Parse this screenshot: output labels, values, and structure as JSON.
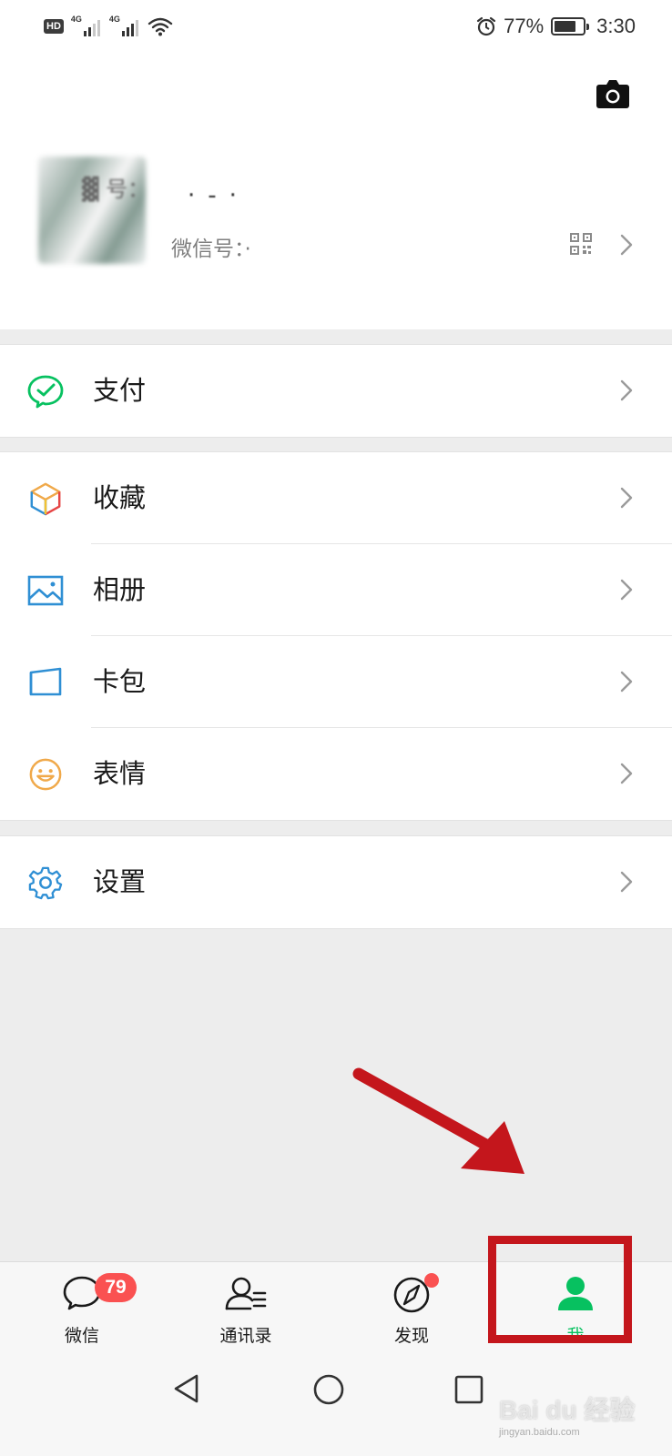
{
  "status_bar": {
    "hd": "HD",
    "network1": "4G",
    "network2": "4G",
    "battery_percent": "77%",
    "battery_level": 0.77,
    "time": "3:30",
    "icons": [
      "signal-icon",
      "wifi-icon",
      "alarm-icon",
      "battery-icon"
    ]
  },
  "profile": {
    "wechat_id_label": "微信号：·"
  },
  "menu": {
    "pay": {
      "label": "支付",
      "icon": "wechat-pay-icon",
      "color": "#07c160"
    },
    "favorites": {
      "label": "收藏",
      "icon": "cube-icon"
    },
    "album": {
      "label": "相册",
      "icon": "picture-icon",
      "color": "#2f8fd4"
    },
    "cards": {
      "label": "卡包",
      "icon": "card-icon",
      "color": "#2f8fd4"
    },
    "stickers": {
      "label": "表情",
      "icon": "smiley-icon",
      "color": "#f0a94a"
    },
    "settings": {
      "label": "设置",
      "icon": "gear-icon",
      "color": "#2f8fd4"
    }
  },
  "tabbar": {
    "chats": {
      "label": "微信",
      "badge": "79"
    },
    "contacts": {
      "label": "通讯录"
    },
    "discover": {
      "label": "发现"
    },
    "me": {
      "label": "我"
    },
    "active_color": "#07c160",
    "badge_color": "#fa5151"
  },
  "watermark": {
    "main": "Bai du 经验",
    "sub": "jingyan.baidu.com"
  }
}
